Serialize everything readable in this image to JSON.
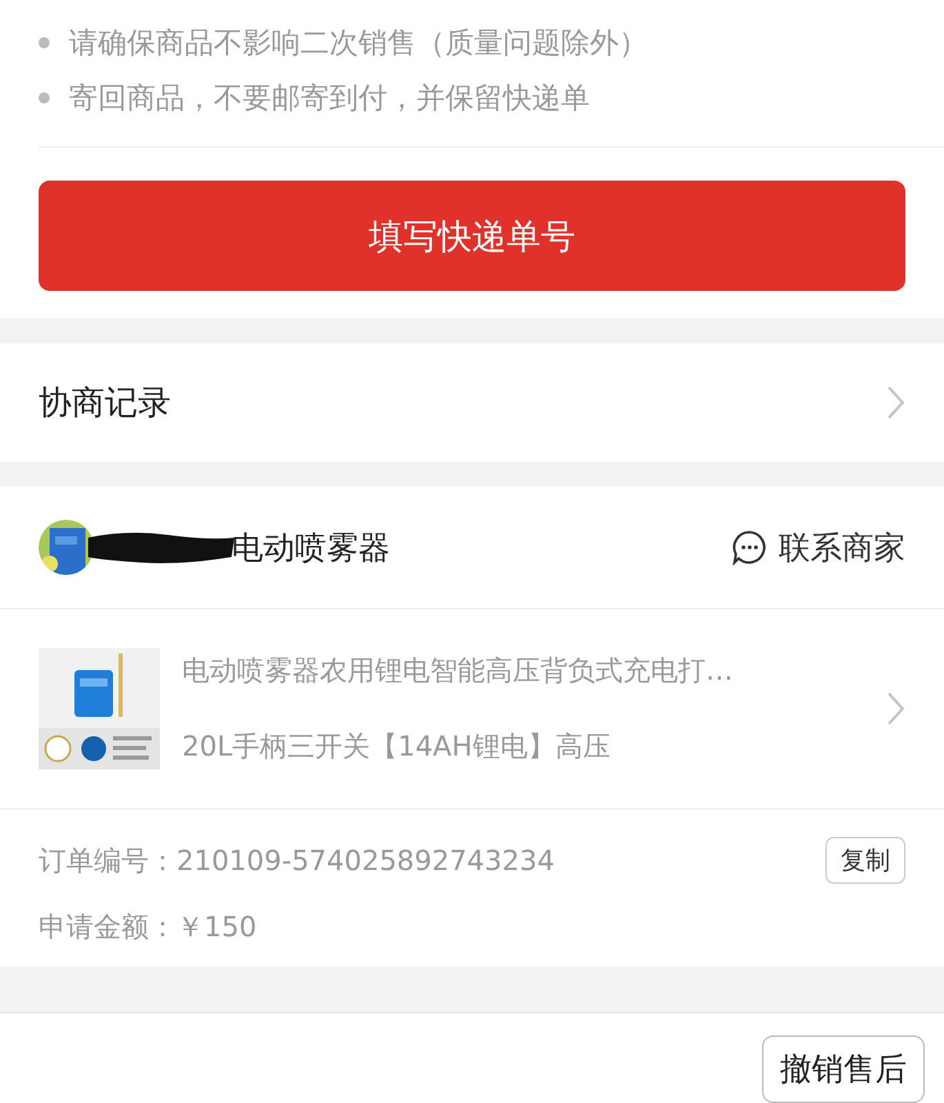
{
  "notes": [
    "请确保商品不影响二次销售（质量问题除外）",
    "寄回商品，不要邮寄到付，并保留快递单"
  ],
  "primary_button": "填写快递单号",
  "negotiation": {
    "label": "协商记录"
  },
  "store": {
    "name": "电动喷雾器",
    "contact": "联系商家"
  },
  "product": {
    "title": "电动喷雾器农用锂电智能高压背负式充电打…",
    "variant": "20L手柄三开关【14AH锂电】高压"
  },
  "details": [
    {
      "label": "订单编号：",
      "value": "210109-574025892743234",
      "action": "复制"
    },
    {
      "label": "申请金额：",
      "value": "￥150"
    }
  ],
  "footer_button": "撤销售后"
}
